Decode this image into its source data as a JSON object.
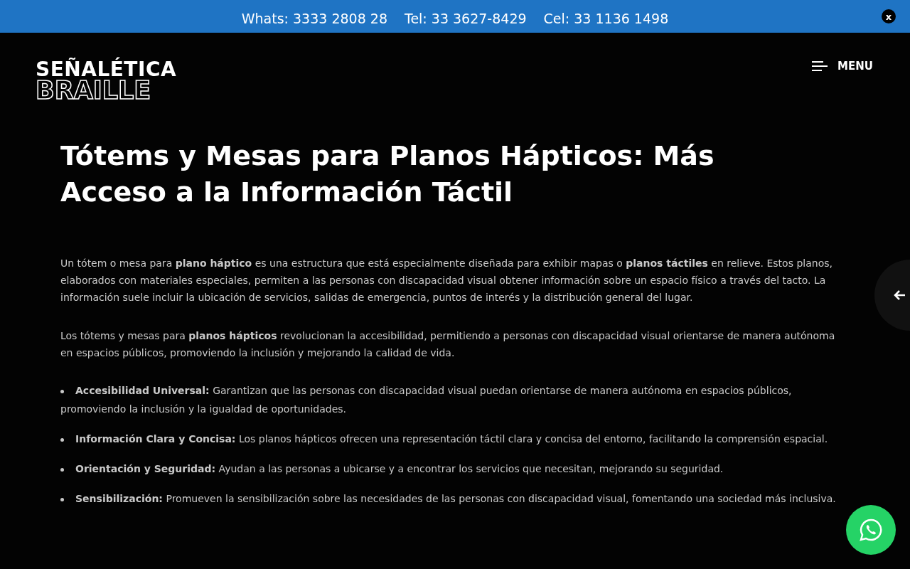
{
  "top_bar": {
    "contacts": [
      "Whats: 3333 2808 28",
      "Tel: 33 3627-8429",
      "Cel: 33 1136 1498"
    ],
    "close": "x"
  },
  "header": {
    "logo_top": "SEÑALÉTICA",
    "logo_bottom": "BRAILLE",
    "menu": "MENU"
  },
  "article": {
    "title": "Tótems y Mesas para Planos Hápticos: Más Acceso a la Información Táctil",
    "paragraphs": [
      "Un tótem o mesa para **plano háptico** es una estructura que está especialmente diseñada para exhibir mapas o **planos táctiles** en relieve. Estos planos, elaborados con materiales especiales, permiten a las personas con discapacidad visual obtener información sobre un espacio físico a través del tacto. La información suele incluir la ubicación de servicios, salidas de emergencia, puntos de interés y la distribución general del lugar.",
      "Los tótems y mesas para **planos hápticos** revolucionan la accesibilidad, permitiendo a personas con discapacidad visual orientarse de manera autónoma en espacios públicos, promoviendo la inclusión y mejorando la calidad de vida."
    ],
    "bullets": [
      "**Accesibilidad Universal:** Garantizan que las personas con discapacidad visual puedan orientarse de manera autónoma en espacios públicos, promoviendo la inclusión y la igualdad de oportunidades.",
      "**Información Clara y Concisa:** Los planos hápticos ofrecen una representación táctil clara y concisa del entorno, facilitando la comprensión espacial.",
      "**Orientación y Seguridad:** Ayudan a las personas a ubicarse y a encontrar los servicios que necesitan, mejorando su seguridad.",
      "**Sensibilización:** Promueven la sensibilización sobre las necesidades de las personas con discapacidad visual, fomentando una sociedad más inclusiva."
    ]
  }
}
